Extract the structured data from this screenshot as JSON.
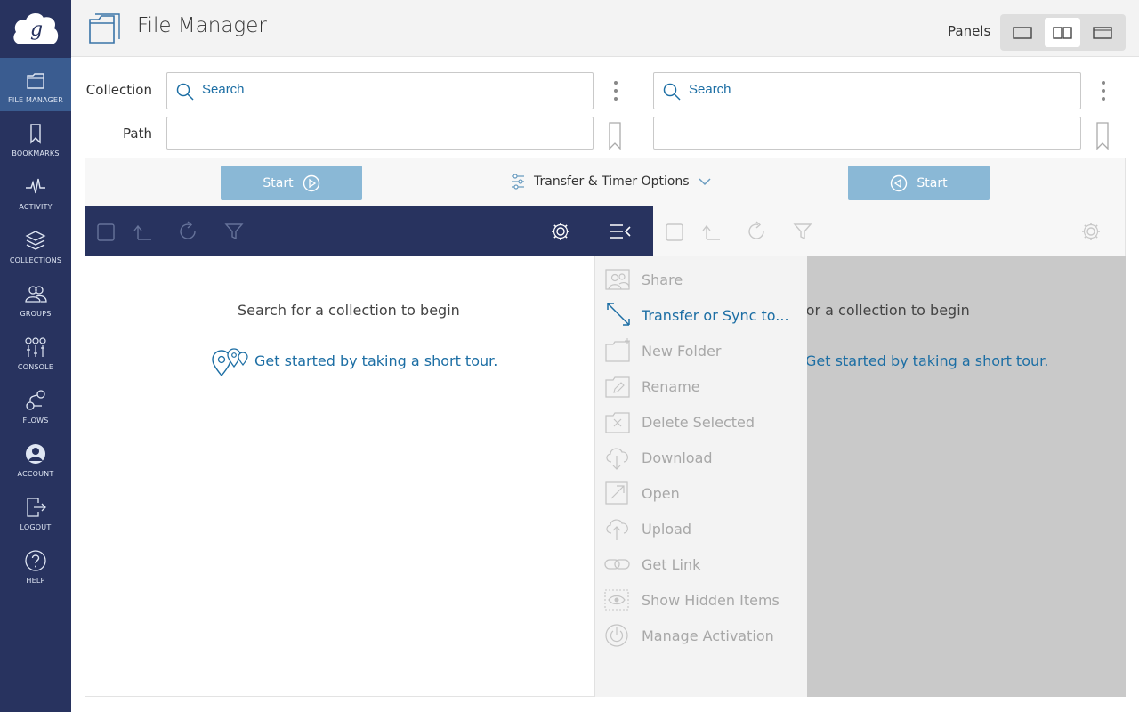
{
  "app": {
    "title": "File Manager"
  },
  "sidebar": {
    "items": [
      {
        "label": "FILE MANAGER",
        "icon": "file-manager-icon"
      },
      {
        "label": "BOOKMARKS",
        "icon": "bookmark-icon"
      },
      {
        "label": "ACTIVITY",
        "icon": "activity-icon"
      },
      {
        "label": "COLLECTIONS",
        "icon": "collections-icon"
      },
      {
        "label": "GROUPS",
        "icon": "groups-icon"
      },
      {
        "label": "CONSOLE",
        "icon": "console-icon"
      },
      {
        "label": "FLOWS",
        "icon": "flows-icon"
      },
      {
        "label": "ACCOUNT",
        "icon": "account-icon"
      },
      {
        "label": "LOGOUT",
        "icon": "logout-icon"
      },
      {
        "label": "HELP",
        "icon": "help-icon"
      }
    ]
  },
  "header": {
    "panels_label": "Panels",
    "active_panel_mode": "two-panel"
  },
  "collection": {
    "label": "Collection",
    "path_label": "Path",
    "left": {
      "search_placeholder": "Search",
      "path_value": ""
    },
    "right": {
      "search_placeholder": "Search",
      "path_value": ""
    }
  },
  "transfer": {
    "start_left": "Start",
    "start_right": "Start",
    "options_label": "Transfer & Timer Options"
  },
  "pane": {
    "left": {
      "hint": "Search for a collection to begin",
      "tour": "Get started by taking a short tour."
    },
    "right": {
      "hint": "Search for a collection to begin",
      "tour": "Get started by taking a short tour."
    }
  },
  "menu": {
    "items": [
      {
        "label": "Share",
        "enabled": false
      },
      {
        "label": "Transfer or Sync to...",
        "enabled": true
      },
      {
        "label": "New Folder",
        "enabled": false
      },
      {
        "label": "Rename",
        "enabled": false
      },
      {
        "label": "Delete Selected",
        "enabled": false
      },
      {
        "label": "Download",
        "enabled": false
      },
      {
        "label": "Open",
        "enabled": false
      },
      {
        "label": "Upload",
        "enabled": false
      },
      {
        "label": "Get Link",
        "enabled": false
      },
      {
        "label": "Show Hidden Items",
        "enabled": false
      },
      {
        "label": "Manage Activation",
        "enabled": false
      }
    ]
  },
  "colors": {
    "sidebar": "#28335f",
    "sidebar_active": "#3a5c90",
    "link": "#1c6ea4",
    "start_button": "#8ab8d6"
  }
}
